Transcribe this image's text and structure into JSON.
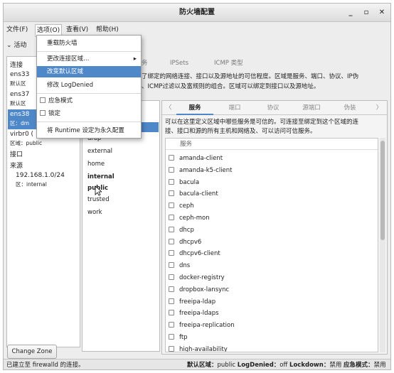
{
  "window": {
    "title": "防火墙配置",
    "min": "_",
    "max": "▫",
    "close": "✕"
  },
  "menubar": {
    "file": "文件(F)",
    "options": "选项(O)",
    "view": "查看(V)",
    "help": "帮助(H)"
  },
  "toprow": {
    "arrow": "⌄",
    "label": "活动"
  },
  "left_panel": {
    "header": "连接",
    "connections": [
      {
        "name": "ens33",
        "zone": "默认区"
      },
      {
        "name": "ens37",
        "zone": "默认区"
      },
      {
        "name": "ens38",
        "zone": "区：dm"
      },
      {
        "name": "virbr0 (",
        "zone": "区域：public"
      }
    ],
    "interfaces_label": "接口",
    "sources_label": "来源",
    "source_ip": "192.168.1.0/24",
    "source_zone": "区：internal",
    "change_zone_button": "Change Zone"
  },
  "tabs": {
    "services_partial": "务",
    "ipsets": "IPSets",
    "icmp": "ICMP 类型"
  },
  "description": "了绑定的网络连接、接口以及源地址的可信程度。区域是服务、端口、协议、IP伪\n、ICMP过滤以及富规则的组合。区域可以绑定到接口以及源地址。",
  "zones": [
    "drop",
    "external",
    "home",
    "internal",
    "public",
    "trusted",
    "work"
  ],
  "right_panel": {
    "tabs": [
      "服务",
      "端口",
      "协议",
      "源端口",
      "伪装"
    ],
    "prev_arrow": "〈",
    "next_arrow": "〉",
    "description": "可以在这里定义区域中哪些服务是可信的。可连接至绑定到这个区域的连\n接、接口和源的所有主机和网络及、可以访问可信服务。",
    "list_header": "服务",
    "services": [
      "amanda-client",
      "amanda-k5-client",
      "bacula",
      "bacula-client",
      "ceph",
      "ceph-mon",
      "dhcp",
      "dhcpv6",
      "dhcpv6-client",
      "dns",
      "docker-registry",
      "dropbox-lansync",
      "freeipa-ldap",
      "freeipa-ldaps",
      "freeipa-replication",
      "ftp",
      "high-availability"
    ]
  },
  "status": {
    "left": "已建立至 firewalld 的连接。",
    "default_zone_label": "默认区域：",
    "default_zone_value": "public",
    "logdenied_label": "LogDenied：",
    "logdenied_value": "off",
    "lockdown_label": "Lockdown：",
    "lockdown_value": "禁用",
    "panic_label": "应急模式：",
    "panic_value": "禁用"
  },
  "options_menu": {
    "reload": "重载防火墙",
    "change_conn_zone": "更改连接区域…",
    "change_default_zone": "改变默认区域",
    "modify_logdenied": "修改 LogDenied",
    "panic_mode": "应急模式",
    "lockdown": "锁定",
    "runtime_to_permanent": "将 Runtime 设定为永久配置",
    "submenu_arrow": "▸"
  },
  "colors": {
    "selection": "#4f88c9",
    "window_bg": "#ededed"
  }
}
